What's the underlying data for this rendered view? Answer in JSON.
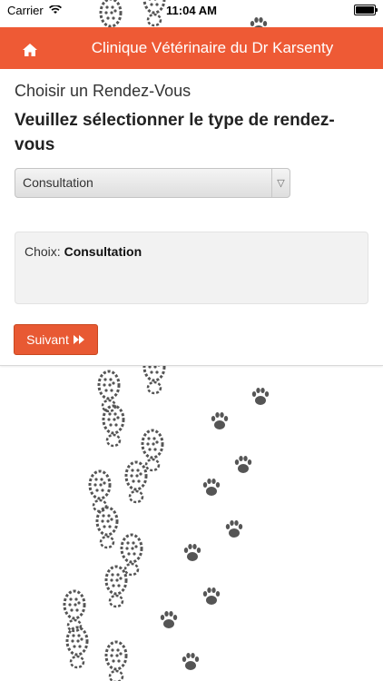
{
  "status_bar": {
    "carrier": "Carrier",
    "time": "11:04 AM"
  },
  "header": {
    "title": "Clinique Vétérinaire du Dr Karsenty",
    "home_icon": "home-icon",
    "color": "#ee5a35"
  },
  "main": {
    "page_title": "Choisir un Rendez-Vous",
    "instruction": "Veuillez sélectionner le type de rendez-vous",
    "select": {
      "value": "Consultation"
    },
    "choice": {
      "label": "Choix:",
      "value": "Consultation"
    },
    "next_button": {
      "label": "Suivant",
      "icon": "fast-forward-icon",
      "color": "#e85933"
    }
  }
}
